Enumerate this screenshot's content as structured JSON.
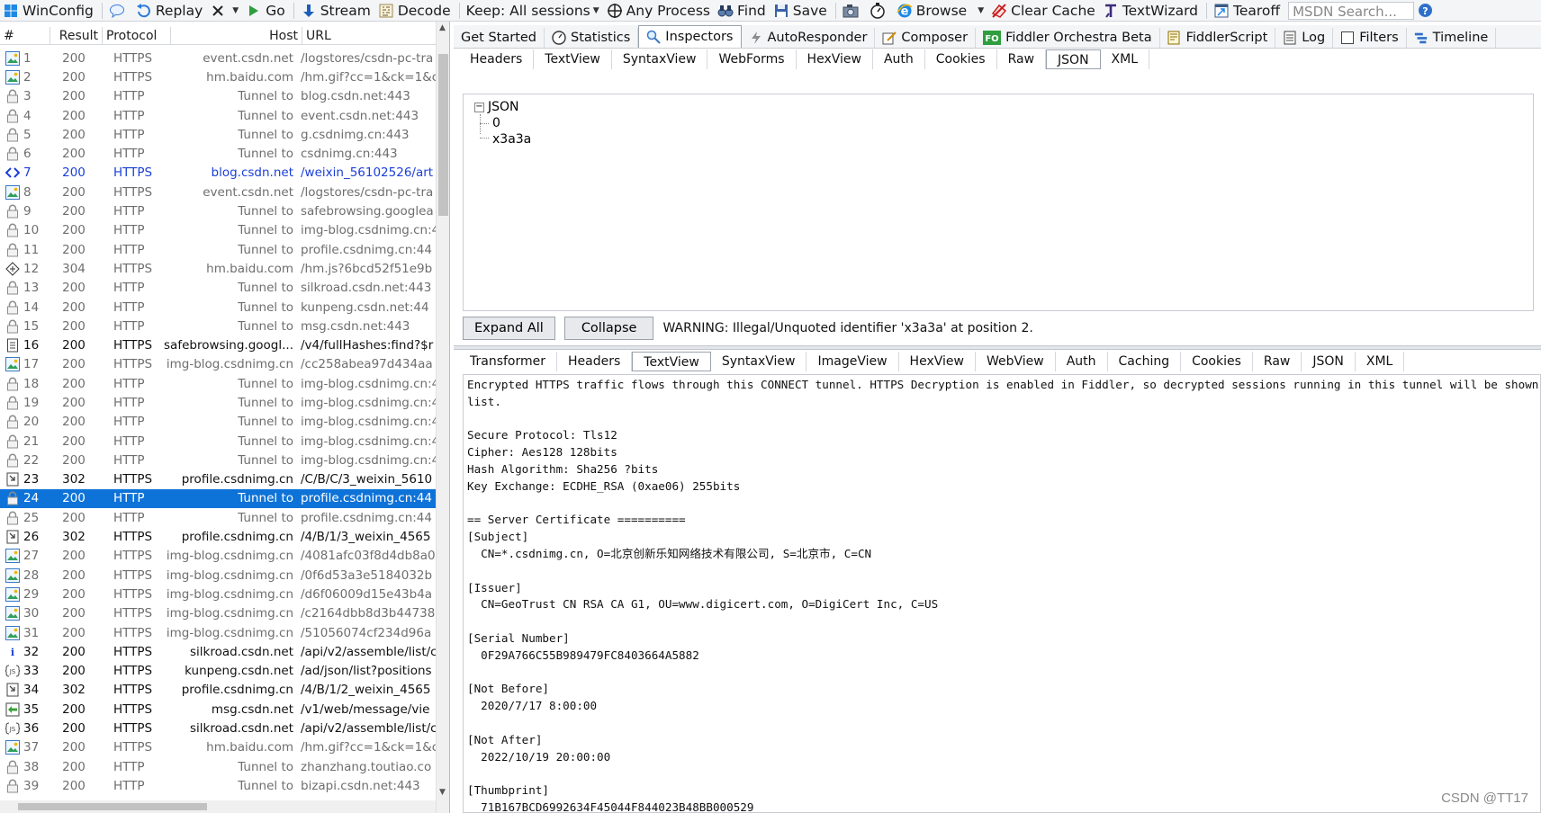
{
  "toolbar": {
    "winconfig": "WinConfig",
    "replay": "Replay",
    "go": "Go",
    "stream": "Stream",
    "decode": "Decode",
    "keep": "Keep: All sessions",
    "any_process": "Any Process",
    "find": "Find",
    "save": "Save",
    "browse": "Browse",
    "clear_cache": "Clear Cache",
    "textwizard": "TextWizard",
    "tearoff": "Tearoff",
    "msdn_placeholder": "MSDN Search..."
  },
  "grid": {
    "columns": [
      "#",
      "Result",
      "Protocol",
      "Host",
      "URL"
    ],
    "rows": [
      {
        "icon": "image-icon",
        "id": "1",
        "result": "200",
        "protocol": "HTTPS",
        "host": "event.csdn.net",
        "url": "/logstores/csdn-pc-tra",
        "style": "normal"
      },
      {
        "icon": "image-icon",
        "id": "2",
        "result": "200",
        "protocol": "HTTPS",
        "host": "hm.baidu.com",
        "url": "/hm.gif?cc=1&ck=1&c",
        "style": "normal"
      },
      {
        "icon": "lock-icon",
        "id": "3",
        "result": "200",
        "protocol": "HTTP",
        "host": "Tunnel to",
        "url": "blog.csdn.net:443",
        "style": "normal"
      },
      {
        "icon": "lock-icon",
        "id": "4",
        "result": "200",
        "protocol": "HTTP",
        "host": "Tunnel to",
        "url": "event.csdn.net:443",
        "style": "normal"
      },
      {
        "icon": "lock-icon",
        "id": "5",
        "result": "200",
        "protocol": "HTTP",
        "host": "Tunnel to",
        "url": "g.csdnimg.cn:443",
        "style": "normal"
      },
      {
        "icon": "lock-icon",
        "id": "6",
        "result": "200",
        "protocol": "HTTP",
        "host": "Tunnel to",
        "url": "csdnimg.cn:443",
        "style": "normal"
      },
      {
        "icon": "html-icon",
        "id": "7",
        "result": "200",
        "protocol": "HTTPS",
        "host": "blog.csdn.net",
        "url": "/weixin_56102526/art",
        "style": "blue"
      },
      {
        "icon": "image-icon",
        "id": "8",
        "result": "200",
        "protocol": "HTTPS",
        "host": "event.csdn.net",
        "url": "/logstores/csdn-pc-tra",
        "style": "normal"
      },
      {
        "icon": "lock-icon",
        "id": "9",
        "result": "200",
        "protocol": "HTTP",
        "host": "Tunnel to",
        "url": "safebrowsing.googlea",
        "style": "normal"
      },
      {
        "icon": "lock-icon",
        "id": "10",
        "result": "200",
        "protocol": "HTTP",
        "host": "Tunnel to",
        "url": "img-blog.csdnimg.cn:4",
        "style": "normal"
      },
      {
        "icon": "lock-icon",
        "id": "11",
        "result": "200",
        "protocol": "HTTP",
        "host": "Tunnel to",
        "url": "profile.csdnimg.cn:44",
        "style": "normal"
      },
      {
        "icon": "cache-icon",
        "id": "12",
        "result": "304",
        "protocol": "HTTPS",
        "host": "hm.baidu.com",
        "url": "/hm.js?6bcd52f51e9b",
        "style": "normal"
      },
      {
        "icon": "lock-icon",
        "id": "13",
        "result": "200",
        "protocol": "HTTP",
        "host": "Tunnel to",
        "url": "silkroad.csdn.net:443",
        "style": "normal"
      },
      {
        "icon": "lock-icon",
        "id": "14",
        "result": "200",
        "protocol": "HTTP",
        "host": "Tunnel to",
        "url": "kunpeng.csdn.net:44",
        "style": "normal"
      },
      {
        "icon": "lock-icon",
        "id": "15",
        "result": "200",
        "protocol": "HTTP",
        "host": "Tunnel to",
        "url": "msg.csdn.net:443",
        "style": "normal"
      },
      {
        "icon": "doc-icon",
        "id": "16",
        "result": "200",
        "protocol": "HTTPS",
        "host": "safebrowsing.googl...",
        "url": "/v4/fullHashes:find?$r",
        "style": "dark"
      },
      {
        "icon": "image-icon",
        "id": "17",
        "result": "200",
        "protocol": "HTTPS",
        "host": "img-blog.csdnimg.cn",
        "url": "/cc258abea97d434aa",
        "style": "normal"
      },
      {
        "icon": "lock-icon",
        "id": "18",
        "result": "200",
        "protocol": "HTTP",
        "host": "Tunnel to",
        "url": "img-blog.csdnimg.cn:4",
        "style": "normal"
      },
      {
        "icon": "lock-icon",
        "id": "19",
        "result": "200",
        "protocol": "HTTP",
        "host": "Tunnel to",
        "url": "img-blog.csdnimg.cn:4",
        "style": "normal"
      },
      {
        "icon": "lock-icon",
        "id": "20",
        "result": "200",
        "protocol": "HTTP",
        "host": "Tunnel to",
        "url": "img-blog.csdnimg.cn:4",
        "style": "normal"
      },
      {
        "icon": "lock-icon",
        "id": "21",
        "result": "200",
        "protocol": "HTTP",
        "host": "Tunnel to",
        "url": "img-blog.csdnimg.cn:4",
        "style": "normal"
      },
      {
        "icon": "lock-icon",
        "id": "22",
        "result": "200",
        "protocol": "HTTP",
        "host": "Tunnel to",
        "url": "img-blog.csdnimg.cn:4",
        "style": "normal"
      },
      {
        "icon": "redirect-icon",
        "id": "23",
        "result": "302",
        "protocol": "HTTPS",
        "host": "profile.csdnimg.cn",
        "url": "/C/B/C/3_weixin_5610",
        "style": "dark"
      },
      {
        "icon": "lock-icon",
        "id": "24",
        "result": "200",
        "protocol": "HTTP",
        "host": "Tunnel to",
        "url": "profile.csdnimg.cn:44",
        "style": "selected"
      },
      {
        "icon": "lock-icon",
        "id": "25",
        "result": "200",
        "protocol": "HTTP",
        "host": "Tunnel to",
        "url": "profile.csdnimg.cn:44",
        "style": "normal"
      },
      {
        "icon": "redirect-icon",
        "id": "26",
        "result": "302",
        "protocol": "HTTPS",
        "host": "profile.csdnimg.cn",
        "url": "/4/B/1/3_weixin_4565",
        "style": "dark"
      },
      {
        "icon": "image-icon",
        "id": "27",
        "result": "200",
        "protocol": "HTTPS",
        "host": "img-blog.csdnimg.cn",
        "url": "/4081afc03f8d4db8a0",
        "style": "normal"
      },
      {
        "icon": "image-icon",
        "id": "28",
        "result": "200",
        "protocol": "HTTPS",
        "host": "img-blog.csdnimg.cn",
        "url": "/0f6d53a3e5184032b",
        "style": "normal"
      },
      {
        "icon": "image-icon",
        "id": "29",
        "result": "200",
        "protocol": "HTTPS",
        "host": "img-blog.csdnimg.cn",
        "url": "/d6f06009d15e43b4a",
        "style": "normal"
      },
      {
        "icon": "image-icon",
        "id": "30",
        "result": "200",
        "protocol": "HTTPS",
        "host": "img-blog.csdnimg.cn",
        "url": "/c2164dbb8d3b44738",
        "style": "normal"
      },
      {
        "icon": "image-icon",
        "id": "31",
        "result": "200",
        "protocol": "HTTPS",
        "host": "img-blog.csdnimg.cn",
        "url": "/51056074cf234d96a",
        "style": "normal"
      },
      {
        "icon": "info-icon",
        "id": "32",
        "result": "200",
        "protocol": "HTTPS",
        "host": "silkroad.csdn.net",
        "url": "/api/v2/assemble/list/c",
        "style": "dark"
      },
      {
        "icon": "js-icon",
        "id": "33",
        "result": "200",
        "protocol": "HTTPS",
        "host": "kunpeng.csdn.net",
        "url": "/ad/json/list?positions",
        "style": "dark"
      },
      {
        "icon": "redirect-icon",
        "id": "34",
        "result": "302",
        "protocol": "HTTPS",
        "host": "profile.csdnimg.cn",
        "url": "/4/B/1/2_weixin_4565",
        "style": "dark"
      },
      {
        "icon": "json-icon",
        "id": "35",
        "result": "200",
        "protocol": "HTTPS",
        "host": "msg.csdn.net",
        "url": "/v1/web/message/vie",
        "style": "dark"
      },
      {
        "icon": "js-icon",
        "id": "36",
        "result": "200",
        "protocol": "HTTPS",
        "host": "silkroad.csdn.net",
        "url": "/api/v2/assemble/list/c",
        "style": "dark"
      },
      {
        "icon": "image-icon",
        "id": "37",
        "result": "200",
        "protocol": "HTTPS",
        "host": "hm.baidu.com",
        "url": "/hm.gif?cc=1&ck=1&c",
        "style": "normal"
      },
      {
        "icon": "lock-icon",
        "id": "38",
        "result": "200",
        "protocol": "HTTP",
        "host": "Tunnel to",
        "url": "zhanzhang.toutiao.co",
        "style": "normal"
      },
      {
        "icon": "lock-icon",
        "id": "39",
        "result": "200",
        "protocol": "HTTP",
        "host": "Tunnel to",
        "url": "bizapi.csdn.net:443",
        "style": "normal"
      }
    ]
  },
  "main_tabs": [
    "Get Started",
    "Statistics",
    "Inspectors",
    "AutoResponder",
    "Composer",
    "Fiddler Orchestra Beta",
    "FiddlerScript",
    "Log",
    "Filters",
    "Timeline"
  ],
  "main_tab_icons": [
    "",
    "stats-icon",
    "inspect-icon",
    "bolt-icon",
    "compose-icon",
    "fo-icon",
    "script-icon",
    "log-icon",
    "filter-icon",
    "timeline-icon"
  ],
  "fo_badge": "FO",
  "active_main_tab": "Inspectors",
  "request_tabs": [
    "Headers",
    "TextView",
    "SyntaxView",
    "WebForms",
    "HexView",
    "Auth",
    "Cookies",
    "Raw",
    "JSON",
    "XML"
  ],
  "active_request_tab": "JSON",
  "json_tree": {
    "root": "JSON",
    "children": [
      "0",
      "x3a3a"
    ]
  },
  "json_buttons": {
    "expand": "Expand All",
    "collapse": "Collapse"
  },
  "json_warning": "WARNING: Illegal/Unquoted identifier 'x3a3a' at position 2.",
  "response_tabs": [
    "Transformer",
    "Headers",
    "TextView",
    "SyntaxView",
    "ImageView",
    "HexView",
    "WebView",
    "Auth",
    "Caching",
    "Cookies",
    "Raw",
    "JSON",
    "XML"
  ],
  "active_response_tab": "TextView",
  "response_text": [
    "Encrypted HTTPS traffic flows through this CONNECT tunnel. HTTPS Decryption is enabled in Fiddler, so decrypted sessions running in this tunnel will be shown in the Web Sessions",
    "list.",
    "",
    "Secure Protocol: Tls12",
    "Cipher: Aes128 128bits",
    "Hash Algorithm: Sha256 ?bits",
    "Key Exchange: ECDHE_RSA (0xae06) 255bits",
    "",
    "== Server Certificate ==========",
    "[Subject]",
    "  CN=*.csdnimg.cn, O=北京创新乐知网络技术有限公司, S=北京市, C=CN",
    "",
    "[Issuer]",
    "  CN=GeoTrust CN RSA CA G1, OU=www.digicert.com, O=DigiCert Inc, C=US",
    "",
    "[Serial Number]",
    "  0F29A766C55B989479FC8403664A5882",
    "",
    "[Not Before]",
    "  2020/7/17 8:00:00",
    "",
    "[Not After]",
    "  2022/10/19 20:00:00",
    "",
    "[Thumbprint]",
    "  71B167BCD6992634F45044F844023B48BB000529"
  ],
  "watermark": "CSDN @TT17"
}
